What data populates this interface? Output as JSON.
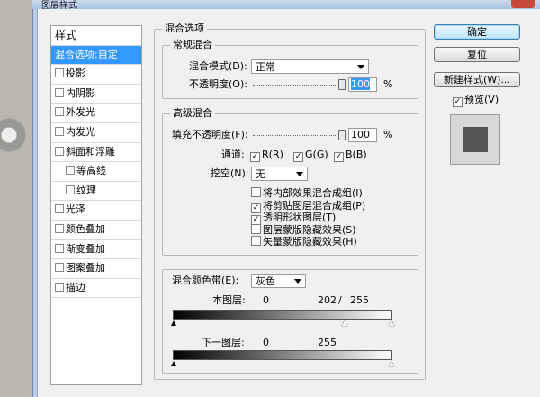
{
  "window": {
    "title": "图层样式"
  },
  "styles_panel": {
    "header": "样式",
    "items": [
      {
        "label": "混合选项:自定",
        "active": true,
        "checkbox": false,
        "indent": false
      },
      {
        "label": "投影",
        "checkbox": true,
        "indent": false
      },
      {
        "label": "内阴影",
        "checkbox": true,
        "indent": false
      },
      {
        "label": "外发光",
        "checkbox": true,
        "indent": false
      },
      {
        "label": "内发光",
        "checkbox": true,
        "indent": false
      },
      {
        "label": "斜面和浮雕",
        "checkbox": true,
        "indent": false
      },
      {
        "label": "等高线",
        "checkbox": true,
        "indent": true
      },
      {
        "label": "纹理",
        "checkbox": true,
        "indent": true
      },
      {
        "label": "光泽",
        "checkbox": true,
        "indent": false
      },
      {
        "label": "颜色叠加",
        "checkbox": true,
        "indent": false
      },
      {
        "label": "渐变叠加",
        "checkbox": true,
        "indent": false
      },
      {
        "label": "图案叠加",
        "checkbox": true,
        "indent": false
      },
      {
        "label": "描边",
        "checkbox": true,
        "indent": false
      }
    ]
  },
  "blend_options": {
    "section_title": "混合选项",
    "general": {
      "title": "常规混合",
      "blend_mode_label": "混合模式(D):",
      "blend_mode_value": "正常",
      "opacity_label": "不透明度(O):",
      "opacity_value": "100",
      "unit": "%"
    },
    "advanced": {
      "title": "高级混合",
      "fill_opacity_label": "填充不透明度(F):",
      "fill_opacity_value": "100",
      "unit": "%",
      "channels_label": "通道:",
      "channel_r": "R(R)",
      "channel_g": "G(G)",
      "channel_b": "B(B)",
      "knockout_label": "挖空(N):",
      "knockout_value": "无",
      "options": [
        {
          "label": "将内部效果混合成组(I)",
          "checked": false
        },
        {
          "label": "将剪贴图层混合成组(P)",
          "checked": true
        },
        {
          "label": "透明形状图层(T)",
          "checked": true
        },
        {
          "label": "图层蒙版隐藏效果(S)",
          "checked": false
        },
        {
          "label": "矢量蒙版隐藏效果(H)",
          "checked": false
        }
      ]
    },
    "blend_if": {
      "label": "混合颜色带(E):",
      "value": "灰色",
      "this_layer_label": "本图层:",
      "this_layer_min": "0",
      "this_layer_split": "202",
      "this_layer_sep": "/",
      "this_layer_max": "255",
      "underlying_label": "下一图层:",
      "underlying_min": "0",
      "underlying_max": "255"
    }
  },
  "buttons": {
    "ok": "确定",
    "reset": "复位",
    "new_style": "新建样式(W)...",
    "preview_label": "预览(V)"
  }
}
